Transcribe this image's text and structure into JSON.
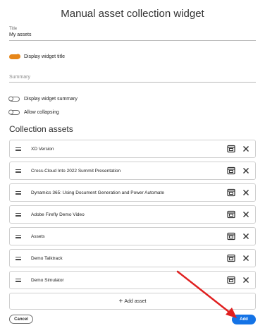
{
  "page": {
    "title": "Manual asset collection widget"
  },
  "title_field": {
    "label": "Title",
    "value": "My assets"
  },
  "toggles": {
    "display_title": {
      "label": "Display widget title",
      "on": true
    },
    "display_summary": {
      "label": "Display widget summary",
      "on": false
    },
    "allow_collapsing": {
      "label": "Allow collapsing",
      "on": false
    }
  },
  "summary_field": {
    "placeholder": "Summary"
  },
  "collection": {
    "title": "Collection assets",
    "assets": [
      {
        "name": "XD Version"
      },
      {
        "name": "Cross-Cloud Into 2022 Summit Presentation"
      },
      {
        "name": "Dynamics 365: Using Document Generation and Power Automate"
      },
      {
        "name": "Adobe Firefly Demo Video"
      },
      {
        "name": "Assets"
      },
      {
        "name": "Demo Talktrack"
      },
      {
        "name": "Demo Simulator"
      }
    ],
    "add_label": "Add asset"
  },
  "actions": {
    "cancel_label": "Cancel",
    "add_label": "Add"
  },
  "icons": {
    "drag": "drag-handle-icon",
    "edit": "edit-asset-icon",
    "remove": "close-icon",
    "add": "plus-icon"
  },
  "colors": {
    "accent": "#e68619",
    "primary": "#1473e6",
    "annotation": "#e02020"
  }
}
